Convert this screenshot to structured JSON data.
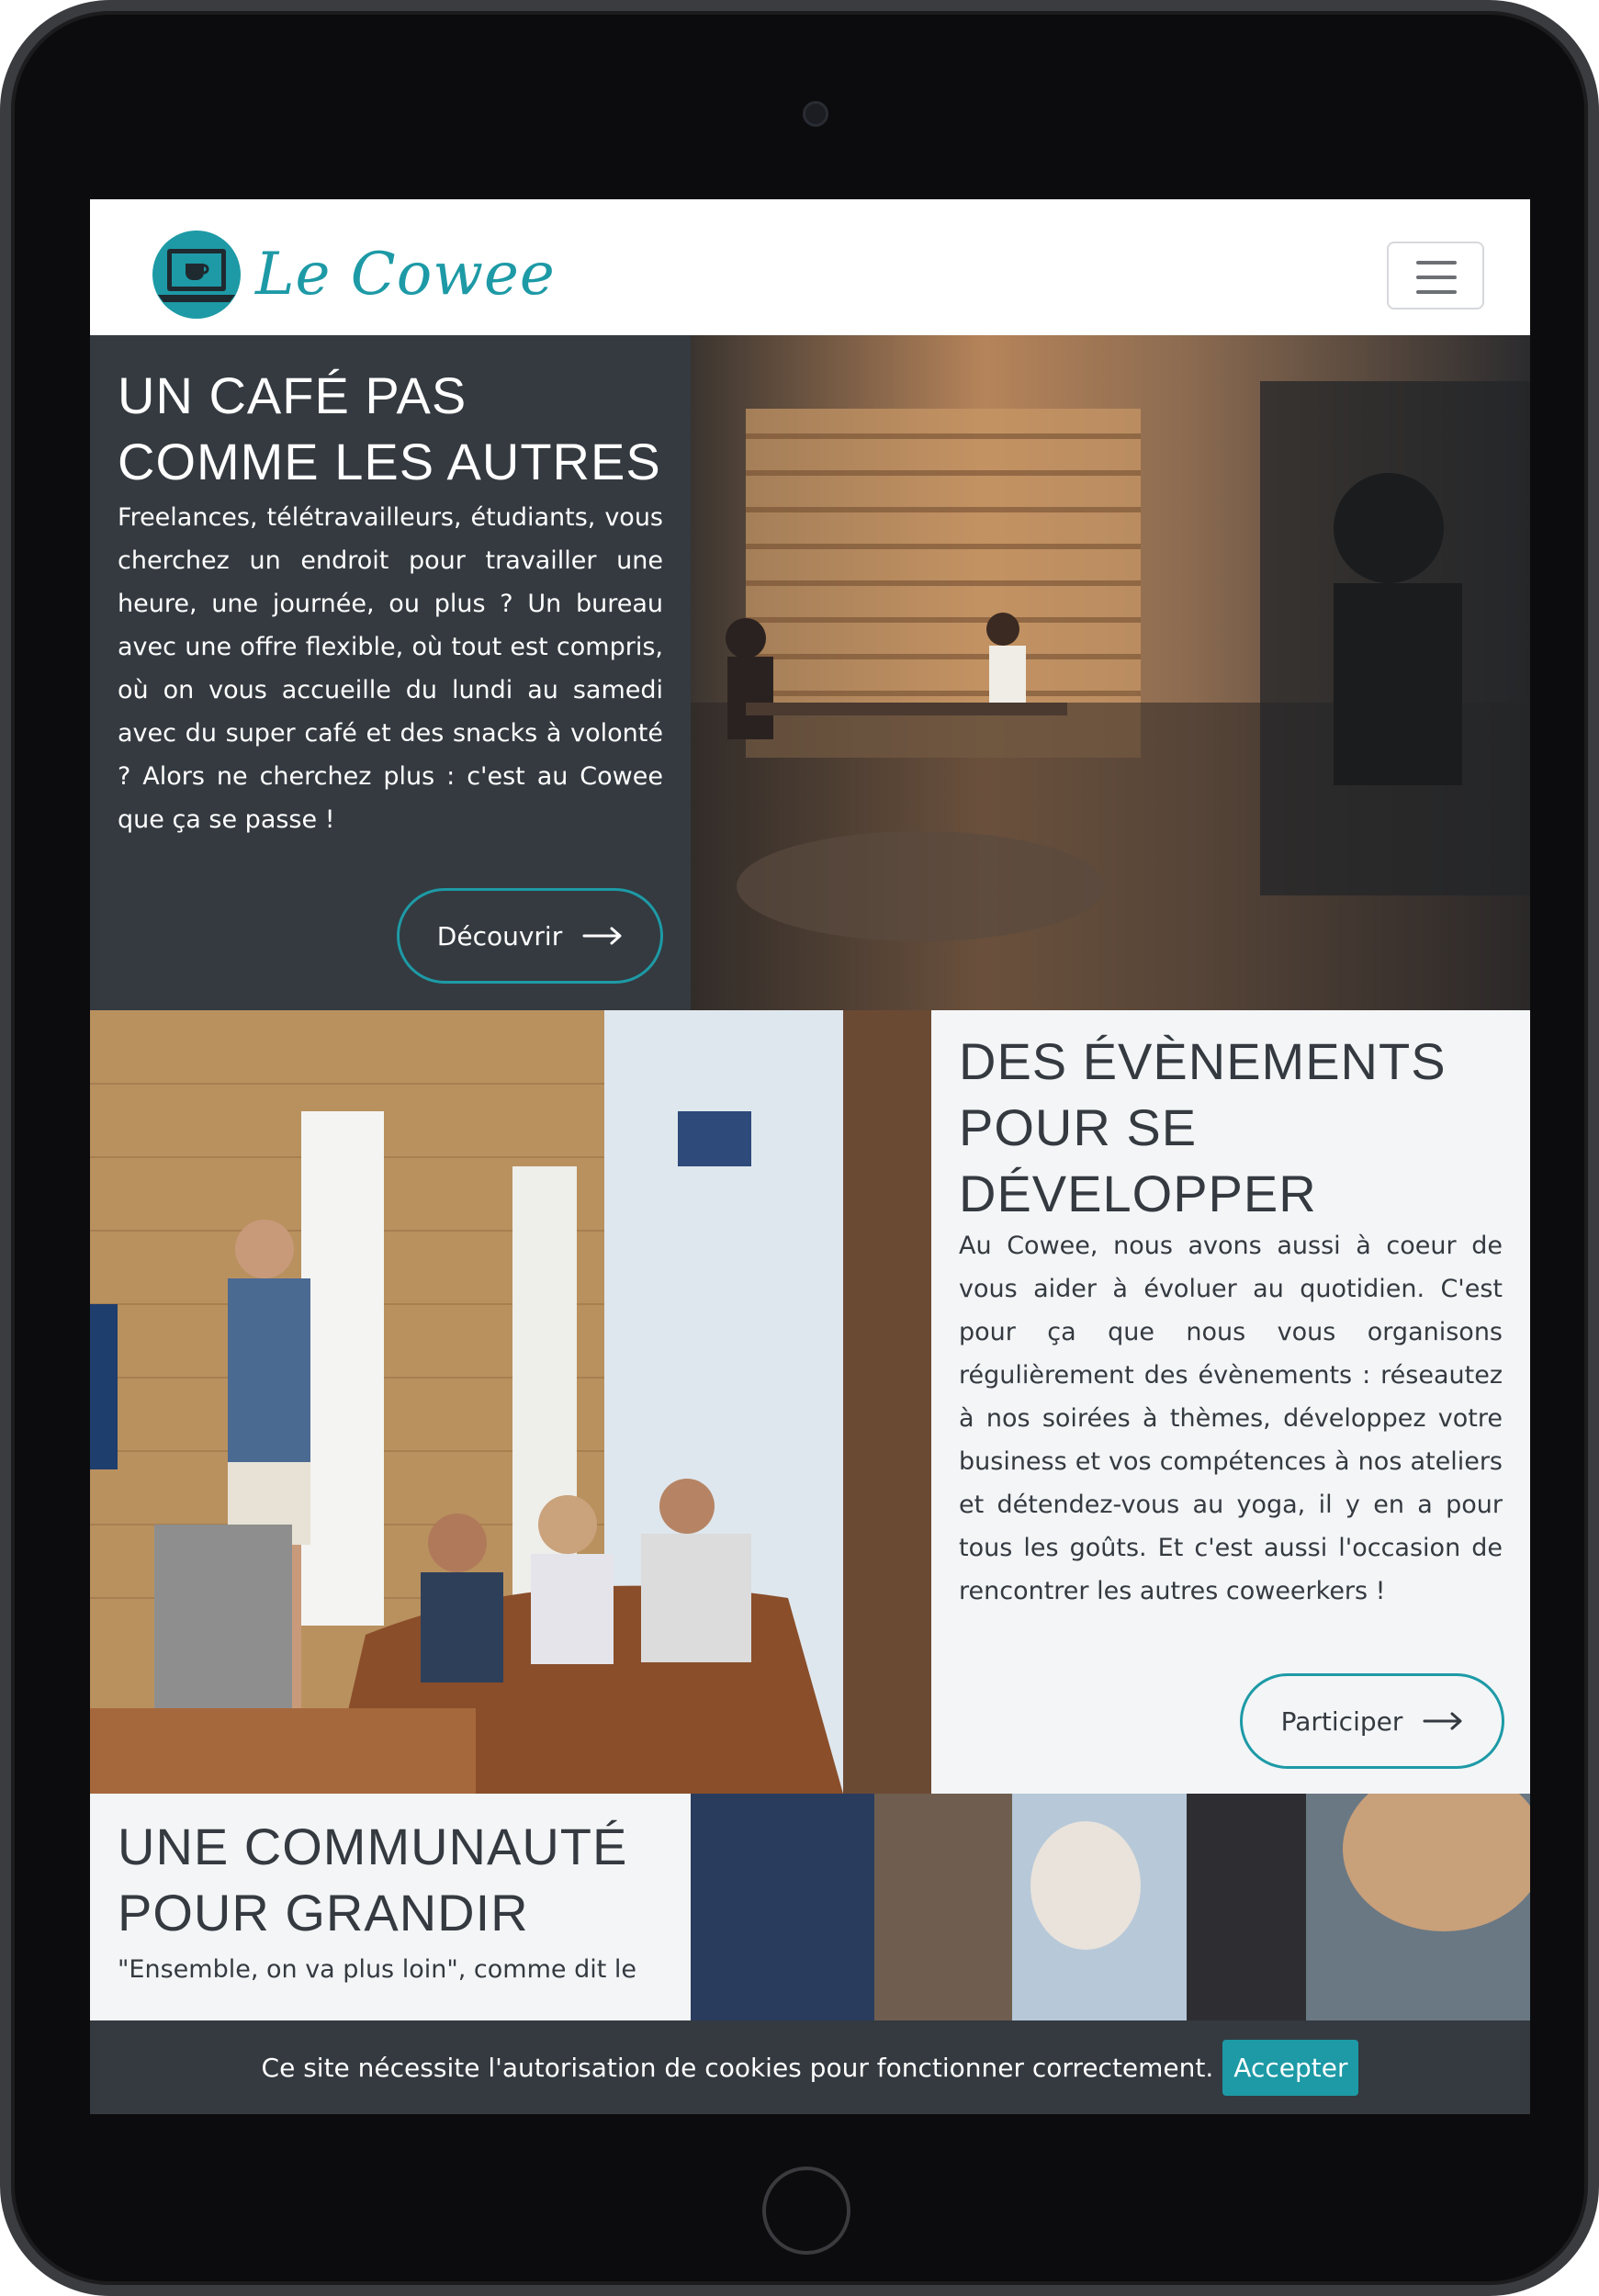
{
  "brand": {
    "name": "Le Cowee",
    "accent": "#1d9aa6",
    "dark": "#343a40",
    "icon": "laptop-coffee-icon"
  },
  "navbar": {
    "toggler_icon": "hamburger-icon"
  },
  "section1": {
    "title": "UN CAFÉ PAS COMME LES AUTRES",
    "text": "Freelances, télétravailleurs, étudiants, vous cherchez un endroit pour travailler une heure, une journée, ou plus ? Un bureau avec une offre flexible, où tout est compris, où on vous accueille du lundi au samedi avec du super café et des snacks à volonté ? Alors ne cherchez plus : c'est au Cowee que ça se passe !",
    "button": "Découvrir"
  },
  "section2": {
    "title": "DES ÉVÈNEMENTS POUR SE DÉVELOPPER",
    "text": "Au Cowee, nous avons aussi à coeur de vous aider à évoluer au quotidien. C'est pour ça que nous vous organisons régulièrement des évènements : réseautez à nos soirées à thèmes, développez votre business et vos compétences à nos ateliers et détendez-vous au yoga, il y en a pour tous les goûts. Et c'est aussi l'occasion de rencontrer les autres coweerkers !",
    "button": "Participer"
  },
  "section3": {
    "title": "UNE COMMUNAUTÉ POUR GRANDIR",
    "text": "\"Ensemble, on va plus loin\", comme dit le"
  },
  "cookie": {
    "text": "Ce site nécessite l'autorisation de cookies pour fonctionner correctement.",
    "button": "Accepter"
  }
}
